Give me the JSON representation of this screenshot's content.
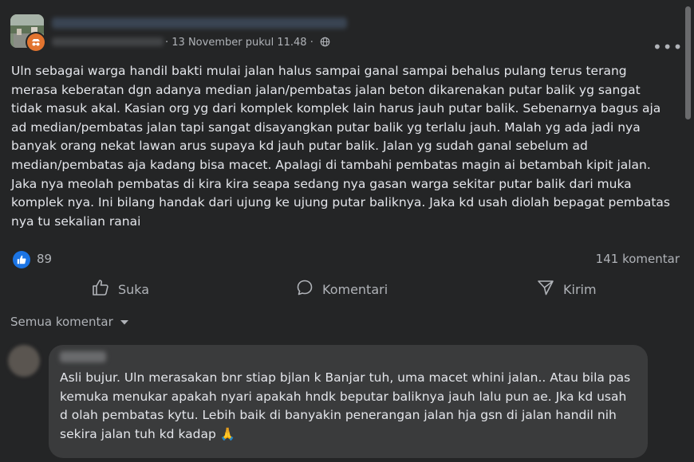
{
  "post": {
    "timestamp": "13 November pukul 11.48",
    "separator": "·",
    "more_label": "•••",
    "text": "Uln sebagai warga handil bakti mulai jalan halus sampai ganal sampai behalus pulang terus terang merasa keberatan dgn adanya median jalan/pembatas jalan beton dikarenakan putar balik yg sangat tidak masuk akal. Kasian org yg dari komplek komplek lain harus jauh putar balik. Sebenarnya bagus aja ad median/pembatas jalan tapi sangat disayangkan putar balik yg terlalu jauh. Malah yg ada jadi nya banyak orang nekat lawan arus supaya kd jauh putar balik. Jalan yg sudah ganal sebelum ad median/pembatas aja kadang bisa macet. Apalagi di tambahi pembatas magin ai betambah kipit jalan. Jaka nya meolah pembatas di kira kira seapa sedang nya gasan warga sekitar putar balik dari muka komplek nya. Ini bilang handak dari ujung ke ujung putar baliknya. Jaka kd usah diolah bepagat pembatas nya tu sekalian ranai",
    "likes": "89",
    "comments": "141 komentar"
  },
  "actions": {
    "like": "Suka",
    "comment": "Komentari",
    "send": "Kirim"
  },
  "filter": {
    "label": "Semua komentar"
  },
  "comment": {
    "text": "Asli bujur. Uln merasakan bnr stiap bjlan k Banjar tuh, uma macet whini jalan.. Atau bila pas kemuka menukar apakah nyari apakah hndk beputar baliknya jauh lalu pun ae. Jka kd usah d olah pembatas kytu. Lebih baik di banyakin penerangan jalan hja gsn di jalan handil nih sekira jalan tuh kd kadap 🙏"
  },
  "colors": {
    "background": "#242526",
    "text": "#e4e6eb",
    "secondary": "#b0b3b8",
    "like_blue": "#1b74e4",
    "bubble": "#3a3b3c"
  },
  "icons": [
    "page-avatar-icon",
    "privacy-badge-icon",
    "globe-icon",
    "more-icon",
    "like-reaction-icon",
    "thumbs-up-icon",
    "comment-icon",
    "send-icon",
    "caret-down-icon"
  ]
}
